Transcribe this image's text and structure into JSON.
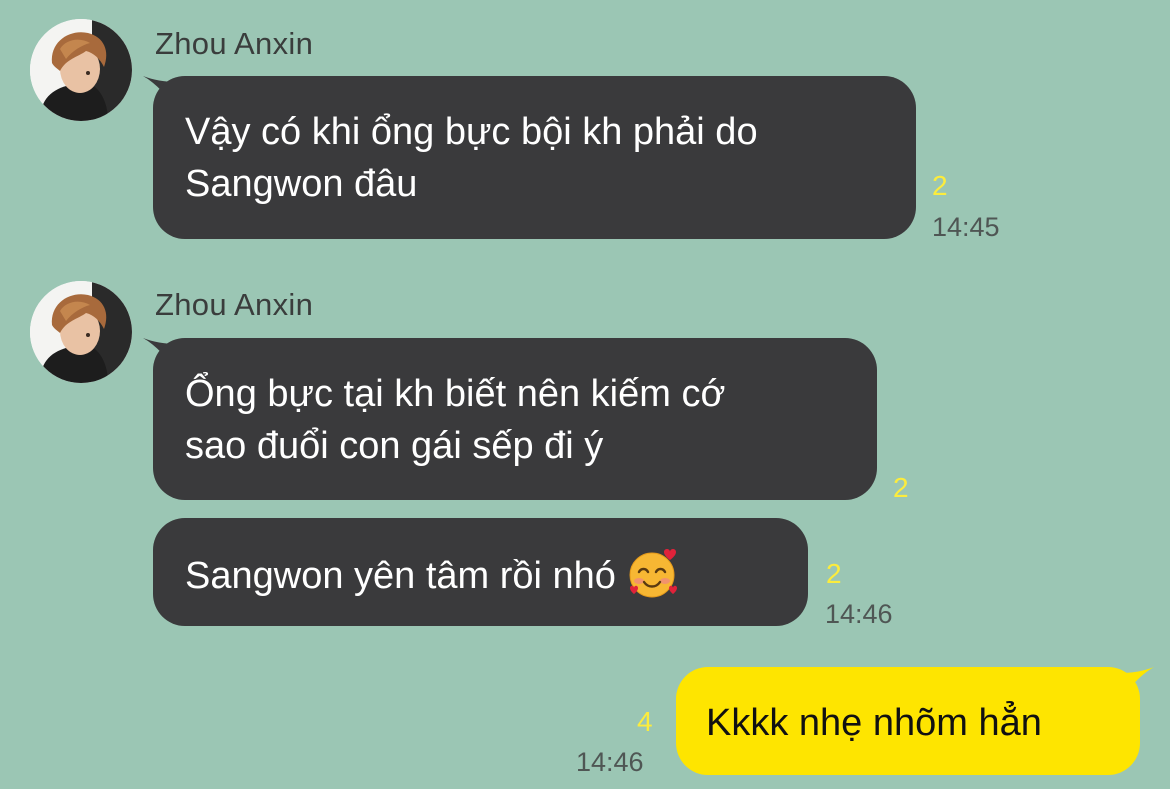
{
  "colors": {
    "background": "#9bc6b4",
    "incoming_bubble": "#3a3a3c",
    "outgoing_bubble": "#fee500",
    "unread_count": "#fcec3c",
    "timestamp": "#4f5654"
  },
  "messages": [
    {
      "direction": "incoming",
      "sender": "Zhou Anxin",
      "avatar_icon": "profile-photo",
      "lines": [
        "Vậy có khi ổng bực bội kh phải do",
        "Sangwon đâu"
      ],
      "unread": "2",
      "time": "14:45"
    },
    {
      "direction": "incoming",
      "sender": "Zhou Anxin",
      "avatar_icon": "profile-photo",
      "lines": [
        "Ổng bực tại kh biết nên kiếm cớ",
        "sao đuổi con gái sếp đi ý"
      ],
      "unread": "2",
      "time": ""
    },
    {
      "direction": "incoming",
      "lines": [
        "Sangwon yên tâm rồi nhó"
      ],
      "emoji": "smiling-face-with-hearts-emoji",
      "unread": "2",
      "time": "14:46"
    },
    {
      "direction": "outgoing",
      "lines": [
        "Kkkk nhẹ nhõm hẳn"
      ],
      "unread": "4",
      "time": "14:46"
    }
  ]
}
